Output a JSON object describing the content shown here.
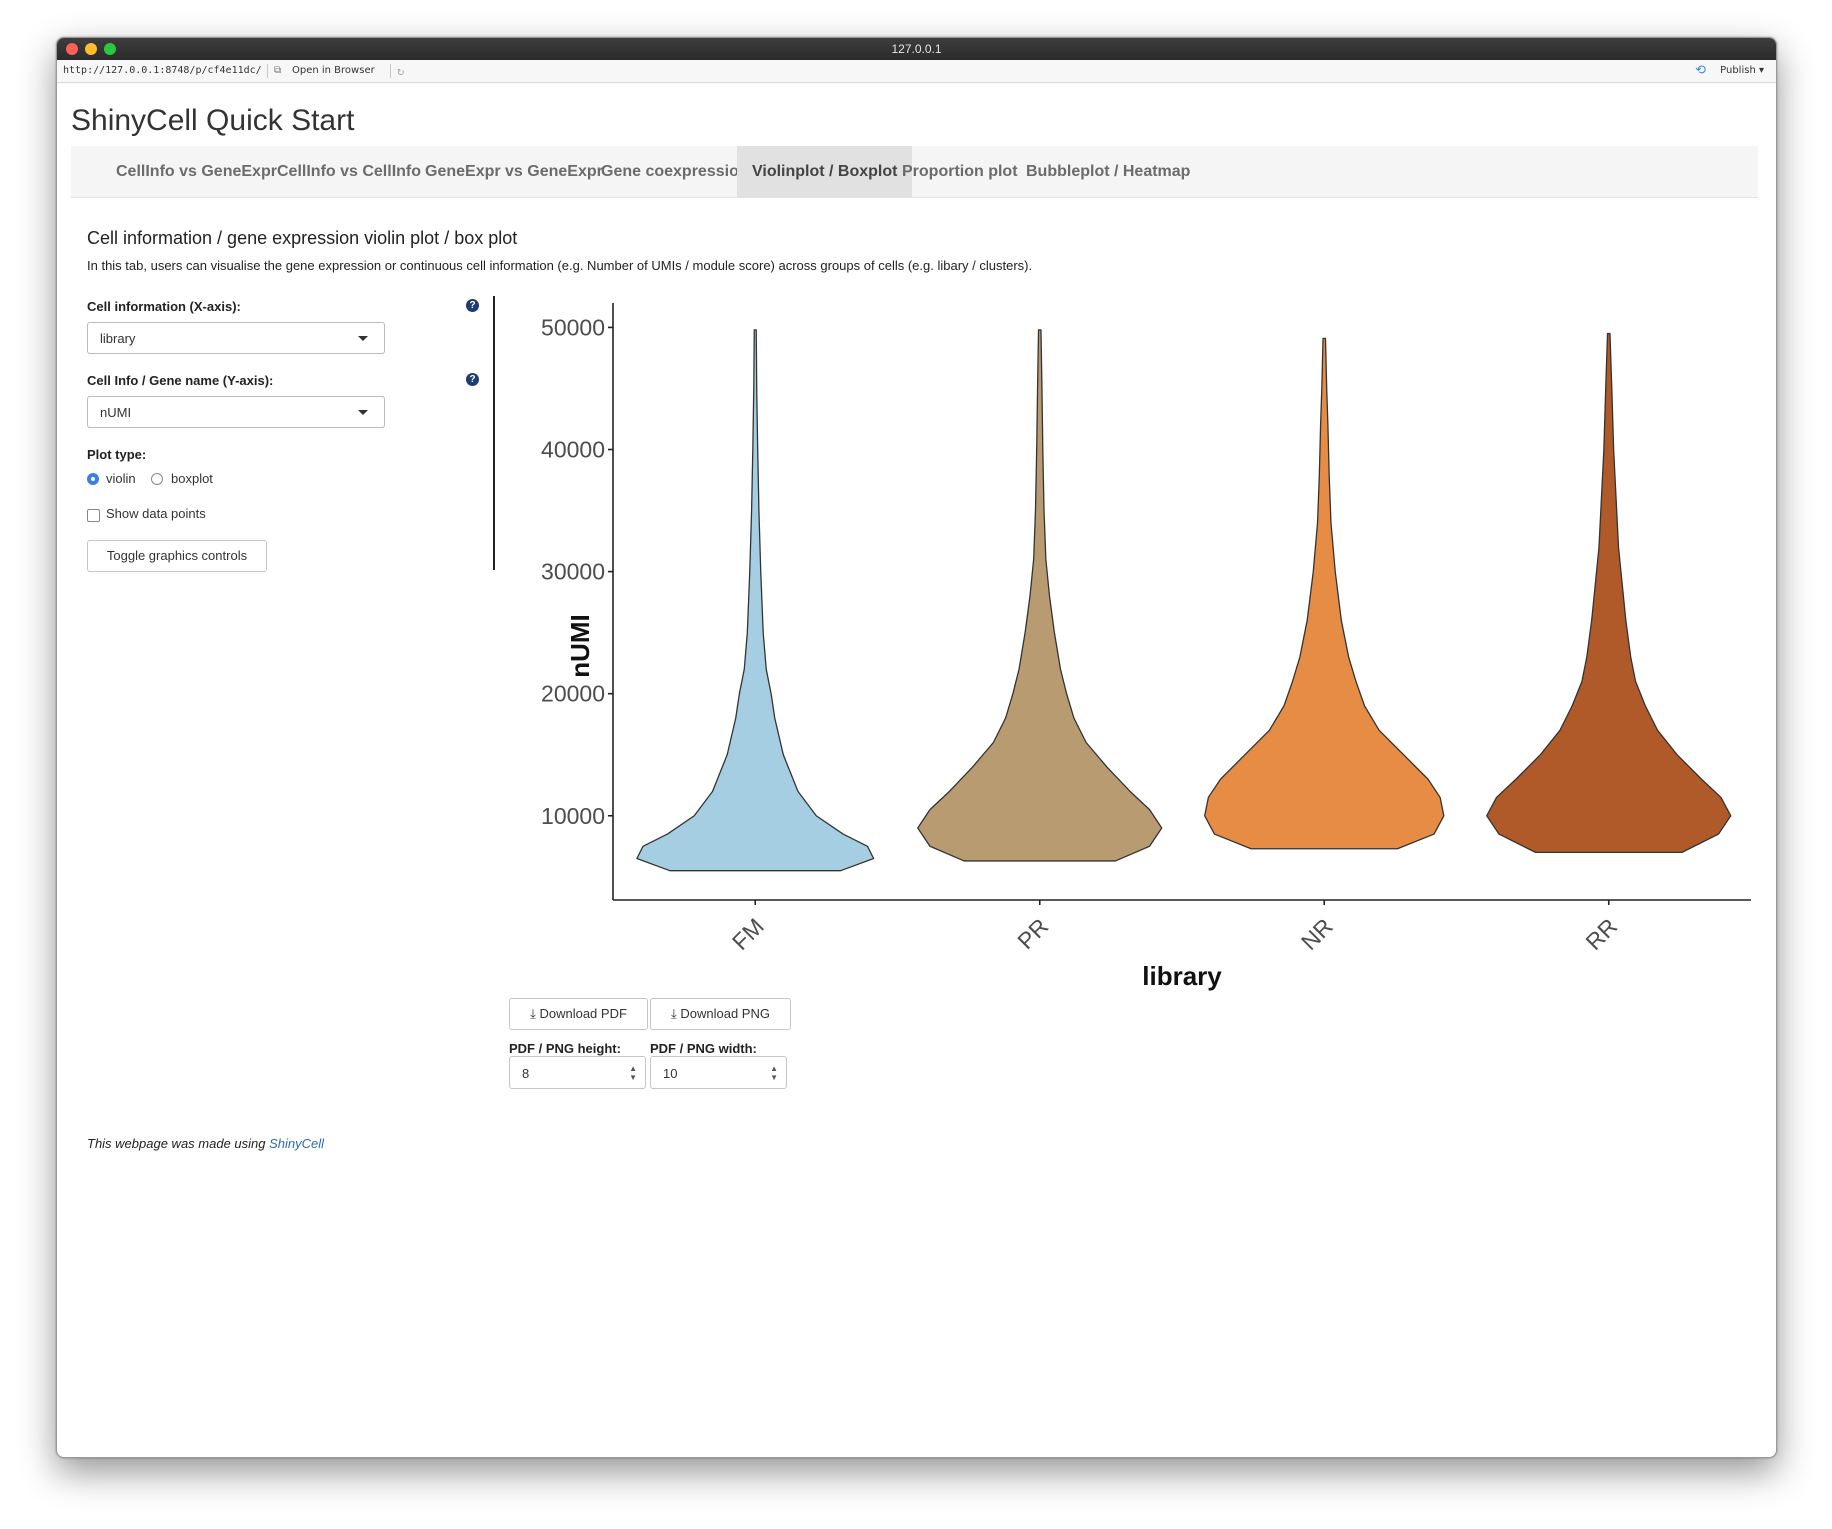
{
  "window": {
    "title": "127.0.0.1"
  },
  "toolbar": {
    "url": "http://127.0.0.1:8748/p/cf4e11dc/",
    "open_label": "Open in Browser",
    "publish_label": "Publish"
  },
  "app": {
    "title": "ShinyCell Quick Start"
  },
  "tabs": [
    {
      "label": "CellInfo vs GeneExpr"
    },
    {
      "label": "CellInfo vs CellInfo"
    },
    {
      "label": "GeneExpr vs GeneExpr"
    },
    {
      "label": "Gene coexpression"
    },
    {
      "label": "Violinplot / Boxplot",
      "active": true
    },
    {
      "label": "Proportion plot"
    },
    {
      "label": "Bubbleplot / Heatmap"
    }
  ],
  "section": {
    "title": "Cell information / gene expression violin plot / box plot",
    "description": "In this tab, users can visualise the gene expression or continuous cell information (e.g. Number of UMIs / module score) across groups of cells (e.g. libary / clusters)."
  },
  "controls": {
    "x_label": "Cell information (X-axis):",
    "x_value": "library",
    "y_label": "Cell Info / Gene name (Y-axis):",
    "y_value": "nUMI",
    "help_icon": "?",
    "plot_type_label": "Plot type:",
    "plot_type_options": [
      "violin",
      "boxplot"
    ],
    "plot_type_selected": "violin",
    "show_points_label": "Show data points",
    "show_points_checked": false,
    "toggle_label": "Toggle graphics controls"
  },
  "chart_data": {
    "type": "violin",
    "categories": [
      "FM",
      "PR",
      "NR",
      "RR"
    ],
    "colors": [
      "#a6cee3",
      "#b99b72",
      "#e78c44",
      "#b05a29"
    ],
    "xlabel": "library",
    "ylabel": "nUMI",
    "yticks": [
      10000,
      20000,
      30000,
      40000,
      50000
    ],
    "ylim": [
      3100,
      52000
    ],
    "series": [
      {
        "name": "FM",
        "min": 5500,
        "max": 49800,
        "profile": [
          [
            5500,
            0.7
          ],
          [
            6500,
            0.97
          ],
          [
            7500,
            0.92
          ],
          [
            8500,
            0.72
          ],
          [
            10000,
            0.5
          ],
          [
            12000,
            0.35
          ],
          [
            15000,
            0.23
          ],
          [
            18000,
            0.16
          ],
          [
            20000,
            0.13
          ],
          [
            22000,
            0.09
          ],
          [
            25000,
            0.065
          ],
          [
            30000,
            0.045
          ],
          [
            35000,
            0.03
          ],
          [
            40000,
            0.02
          ],
          [
            45000,
            0.012
          ],
          [
            49800,
            0.008
          ]
        ]
      },
      {
        "name": "PR",
        "min": 6300,
        "max": 49800,
        "profile": [
          [
            6300,
            0.62
          ],
          [
            7500,
            0.9
          ],
          [
            9000,
            1.0
          ],
          [
            10500,
            0.9
          ],
          [
            12000,
            0.74
          ],
          [
            14000,
            0.55
          ],
          [
            16000,
            0.38
          ],
          [
            18000,
            0.28
          ],
          [
            20000,
            0.22
          ],
          [
            22000,
            0.17
          ],
          [
            25000,
            0.12
          ],
          [
            28000,
            0.08
          ],
          [
            31000,
            0.05
          ],
          [
            35000,
            0.035
          ],
          [
            40000,
            0.025
          ],
          [
            45000,
            0.018
          ],
          [
            49800,
            0.01
          ]
        ]
      },
      {
        "name": "NR",
        "min": 7300,
        "max": 49100,
        "profile": [
          [
            7300,
            0.6
          ],
          [
            8500,
            0.9
          ],
          [
            10000,
            0.98
          ],
          [
            11500,
            0.95
          ],
          [
            13000,
            0.85
          ],
          [
            15000,
            0.65
          ],
          [
            17000,
            0.45
          ],
          [
            19000,
            0.33
          ],
          [
            21000,
            0.26
          ],
          [
            23000,
            0.2
          ],
          [
            26000,
            0.14
          ],
          [
            30000,
            0.09
          ],
          [
            34000,
            0.055
          ],
          [
            38000,
            0.04
          ],
          [
            42000,
            0.03
          ],
          [
            45000,
            0.02
          ],
          [
            49100,
            0.01
          ]
        ]
      },
      {
        "name": "RR",
        "min": 7000,
        "max": 49500,
        "profile": [
          [
            7000,
            0.6
          ],
          [
            8500,
            0.9
          ],
          [
            10000,
            1.0
          ],
          [
            11500,
            0.92
          ],
          [
            13000,
            0.76
          ],
          [
            15000,
            0.56
          ],
          [
            17000,
            0.4
          ],
          [
            19000,
            0.3
          ],
          [
            21000,
            0.22
          ],
          [
            23000,
            0.18
          ],
          [
            26000,
            0.14
          ],
          [
            29000,
            0.11
          ],
          [
            32000,
            0.08
          ],
          [
            36000,
            0.06
          ],
          [
            40000,
            0.04
          ],
          [
            45000,
            0.025
          ],
          [
            49500,
            0.01
          ]
        ]
      }
    ]
  },
  "download": {
    "pdf_label": "Download PDF",
    "png_label": "Download PNG",
    "height_label": "PDF / PNG height:",
    "width_label": "PDF / PNG width:",
    "height_value": "8",
    "width_value": "10"
  },
  "footer": {
    "text": "This webpage was made using ",
    "link": "ShinyCell"
  }
}
